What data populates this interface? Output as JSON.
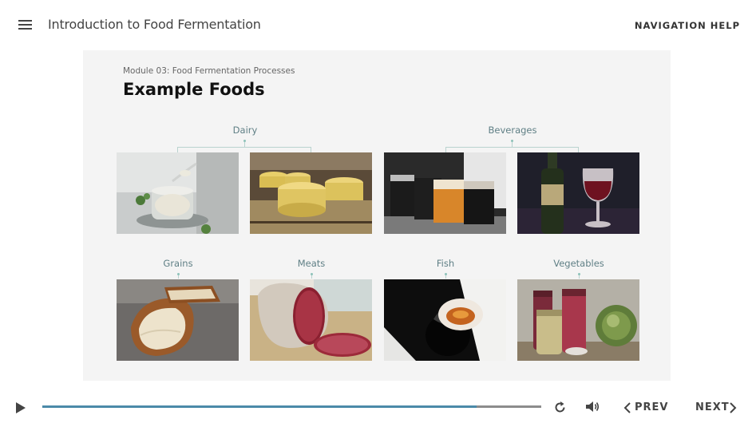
{
  "header": {
    "menu_icon": "hamburger-menu-icon",
    "course_title": "Introduction to Food Fermentation",
    "nav_help": "NAVIGATION HELP"
  },
  "slide": {
    "module_label": "Module 03: Food Fermentation Processes",
    "title": "Example Foods",
    "groups": [
      {
        "label": "Dairy"
      },
      {
        "label": "Beverages"
      },
      {
        "label": "Grains"
      },
      {
        "label": "Meats"
      },
      {
        "label": "Fish"
      },
      {
        "label": "Vegetables"
      }
    ],
    "images": [
      {
        "depicts": "yogurt-with-spoon"
      },
      {
        "depicts": "cheese-wheels"
      },
      {
        "depicts": "beer-glasses"
      },
      {
        "depicts": "red-wine-bottle-and-glass"
      },
      {
        "depicts": "sourdough-bread"
      },
      {
        "depicts": "salami"
      },
      {
        "depicts": "fish-sauce-bowl"
      },
      {
        "depicts": "pickled-vegetable-jars-and-cabbage"
      }
    ]
  },
  "controls": {
    "play_icon": "play-icon",
    "progress": 0.87,
    "replay_icon": "replay-icon",
    "volume_icon": "volume-icon",
    "prev_label": "PREV",
    "next_label": "NEXT",
    "colors": {
      "progress_fill": "#4b8aa8",
      "progress_track": "#8c8c8c",
      "slide_bg": "#f4f4f4",
      "group_label": "#5f7f85"
    }
  }
}
